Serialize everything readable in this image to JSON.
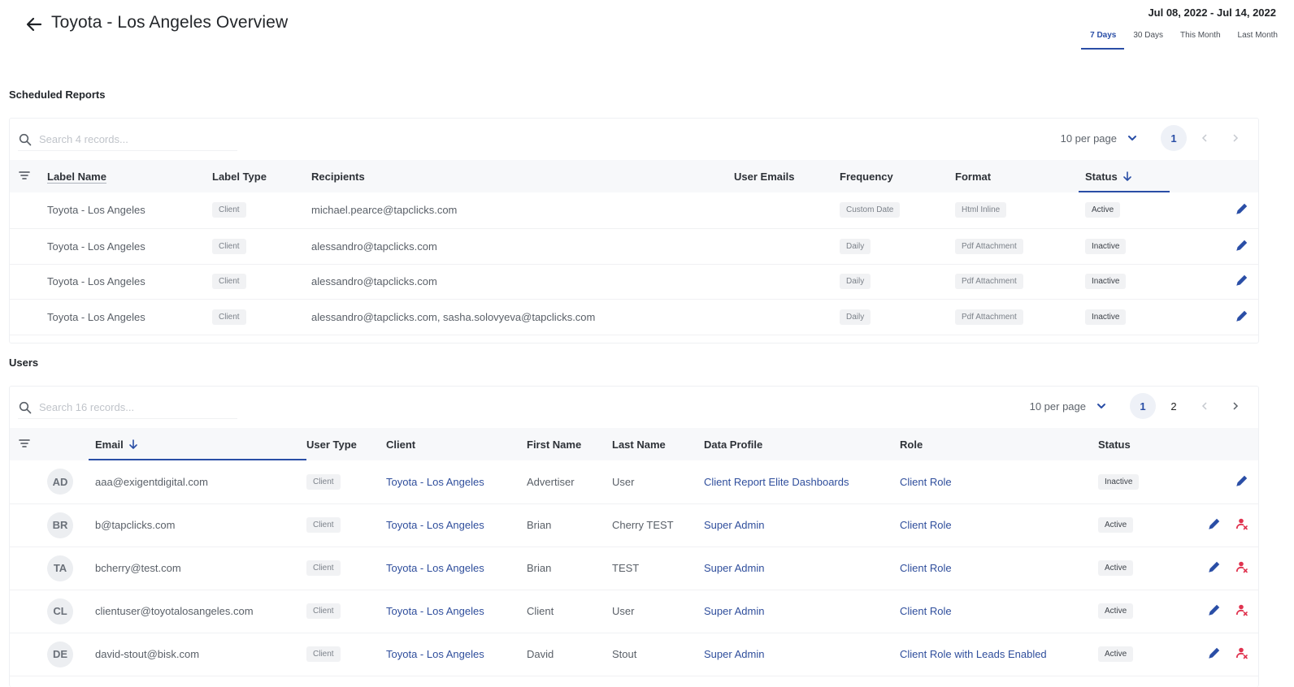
{
  "header": {
    "title": "Toyota - Los Angeles Overview",
    "date_range": "Jul 08, 2022 - Jul 14, 2022",
    "range_tabs": [
      "7 Days",
      "30 Days",
      "This Month",
      "Last Month"
    ],
    "active_range": "7 Days"
  },
  "reports": {
    "title": "Scheduled Reports",
    "search_placeholder": "Search 4 records...",
    "per_page": "10 per page",
    "pages": [
      "1"
    ],
    "current_page": "1",
    "columns": [
      "Label Name",
      "Label Type",
      "Recipients",
      "User Emails",
      "Frequency",
      "Format",
      "Status"
    ],
    "sorted_column": "Status",
    "rows": [
      {
        "label": "Toyota - Los Angeles",
        "type": "Client",
        "recipients": "michael.pearce@tapclicks.com",
        "user_emails": "",
        "frequency": "Custom Date",
        "format": "Html Inline",
        "status": "Active"
      },
      {
        "label": "Toyota - Los Angeles",
        "type": "Client",
        "recipients": "alessandro@tapclicks.com",
        "user_emails": "",
        "frequency": "Daily",
        "format": "Pdf Attachment",
        "status": "Inactive"
      },
      {
        "label": "Toyota - Los Angeles",
        "type": "Client",
        "recipients": "alessandro@tapclicks.com",
        "user_emails": "",
        "frequency": "Daily",
        "format": "Pdf Attachment",
        "status": "Inactive"
      },
      {
        "label": "Toyota - Los Angeles",
        "type": "Client",
        "recipients": "alessandro@tapclicks.com, sasha.solovyeva@tapclicks.com",
        "user_emails": "",
        "frequency": "Daily",
        "format": "Pdf Attachment",
        "status": "Inactive"
      }
    ]
  },
  "users": {
    "title": "Users",
    "search_placeholder": "Search 16 records...",
    "per_page": "10 per page",
    "pages": [
      "1",
      "2"
    ],
    "current_page": "1",
    "columns": [
      "Email",
      "User Type",
      "Client",
      "First Name",
      "Last Name",
      "Data Profile",
      "Role",
      "Status"
    ],
    "sorted_column": "Email",
    "rows": [
      {
        "initials": "AD",
        "email": "aaa@exigentdigital.com",
        "type": "Client",
        "client": "Toyota - Los Angeles",
        "first": "Advertiser",
        "last": "User",
        "profile": "Client Report Elite Dashboards",
        "role": "Client Role",
        "status": "Inactive",
        "can_remove": false
      },
      {
        "initials": "BR",
        "email": "b@tapclicks.com",
        "type": "Client",
        "client": "Toyota - Los Angeles",
        "first": "Brian",
        "last": "Cherry TEST",
        "profile": "Super Admin",
        "role": "Client Role",
        "status": "Active",
        "can_remove": true
      },
      {
        "initials": "TA",
        "email": "bcherry@test.com",
        "type": "Client",
        "client": "Toyota - Los Angeles",
        "first": "Brian",
        "last": "TEST",
        "profile": "Super Admin",
        "role": "Client Role",
        "status": "Active",
        "can_remove": true
      },
      {
        "initials": "CL",
        "email": "clientuser@toyotalosangeles.com",
        "type": "Client",
        "client": "Toyota - Los Angeles",
        "first": "Client",
        "last": "User",
        "profile": "Super Admin",
        "role": "Client Role",
        "status": "Active",
        "can_remove": true
      },
      {
        "initials": "DE",
        "email": "david-stout@bisk.com",
        "type": "Client",
        "client": "Toyota - Los Angeles",
        "first": "David",
        "last": "Stout",
        "profile": "Super Admin",
        "role": "Client Role with Leads Enabled",
        "status": "Active",
        "can_remove": true
      }
    ]
  },
  "colors": {
    "accent": "#2a4ea6",
    "link": "#2f4e9c",
    "remove": "#e0334f",
    "header_bg": "#f7f8fa"
  },
  "icons": {
    "back": "arrow-left-icon",
    "search": "search-icon",
    "filter": "filter-lines-icon",
    "sort": "arrow-down-icon",
    "edit": "pencil-icon",
    "remove": "remove-user-icon",
    "chevron": "chevron-down-icon",
    "prev": "chevron-left-icon",
    "next": "chevron-right-icon"
  }
}
